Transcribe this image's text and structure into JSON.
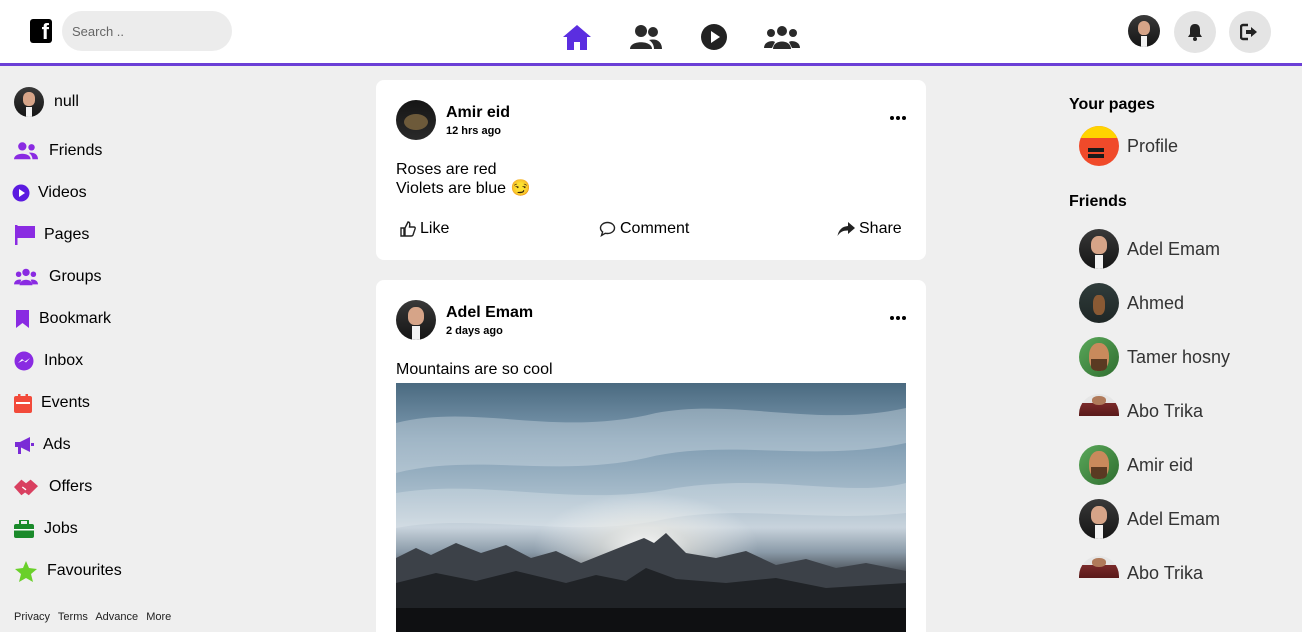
{
  "header": {
    "logo_letter": "f",
    "search_placeholder": "Search ..",
    "accent": "#6b3fd6"
  },
  "sidebar": {
    "user": "null",
    "items": [
      {
        "label": "Friends",
        "icon": "friends-icon",
        "color": "#8a2be2"
      },
      {
        "label": "Videos",
        "icon": "play-icon",
        "color": "#5b1ae0"
      },
      {
        "label": "Pages",
        "icon": "flag-icon",
        "color": "#8a2be2"
      },
      {
        "label": "Groups",
        "icon": "groups-icon",
        "color": "#8a2be2"
      },
      {
        "label": "Bookmark",
        "icon": "bookmark-icon",
        "color": "#8a2be2"
      },
      {
        "label": "Inbox",
        "icon": "messenger-icon",
        "color": "#8a2be2"
      },
      {
        "label": "Events",
        "icon": "calendar-icon",
        "color": "#f24a3a"
      },
      {
        "label": "Ads",
        "icon": "megaphone-icon",
        "color": "#7a2bd6"
      },
      {
        "label": "Offers",
        "icon": "handshake-icon",
        "color": "#d94060"
      },
      {
        "label": "Jobs",
        "icon": "briefcase-icon",
        "color": "#1a8a2a"
      },
      {
        "label": "Favourites",
        "icon": "star-icon",
        "color": "#6ad02a"
      }
    ],
    "footer": [
      "Privacy",
      "Terms",
      "Advance",
      "More"
    ]
  },
  "posts": [
    {
      "author": "Amir eid",
      "time": "12 hrs ago",
      "lines": [
        "Roses are red",
        "Violets are blue 😏"
      ],
      "actions": {
        "like": "Like",
        "comment": "Comment",
        "share": "Share"
      }
    },
    {
      "author": "Adel Emam",
      "time": "2 days ago",
      "lines": [
        "Mountains are so cool"
      ]
    }
  ],
  "right": {
    "pages_title": "Your pages",
    "pages": [
      {
        "name": "Profile"
      }
    ],
    "friends_title": "Friends",
    "friends": [
      {
        "name": "Adel Emam",
        "avatar": "man"
      },
      {
        "name": "Ahmed",
        "avatar": "dark"
      },
      {
        "name": "Tamer hosny",
        "avatar": "beard"
      },
      {
        "name": "Abo Trika",
        "avatar": "trika"
      },
      {
        "name": "Amir eid",
        "avatar": "beard"
      },
      {
        "name": "Adel Emam",
        "avatar": "man"
      },
      {
        "name": "Abo Trika",
        "avatar": "trika"
      }
    ]
  }
}
